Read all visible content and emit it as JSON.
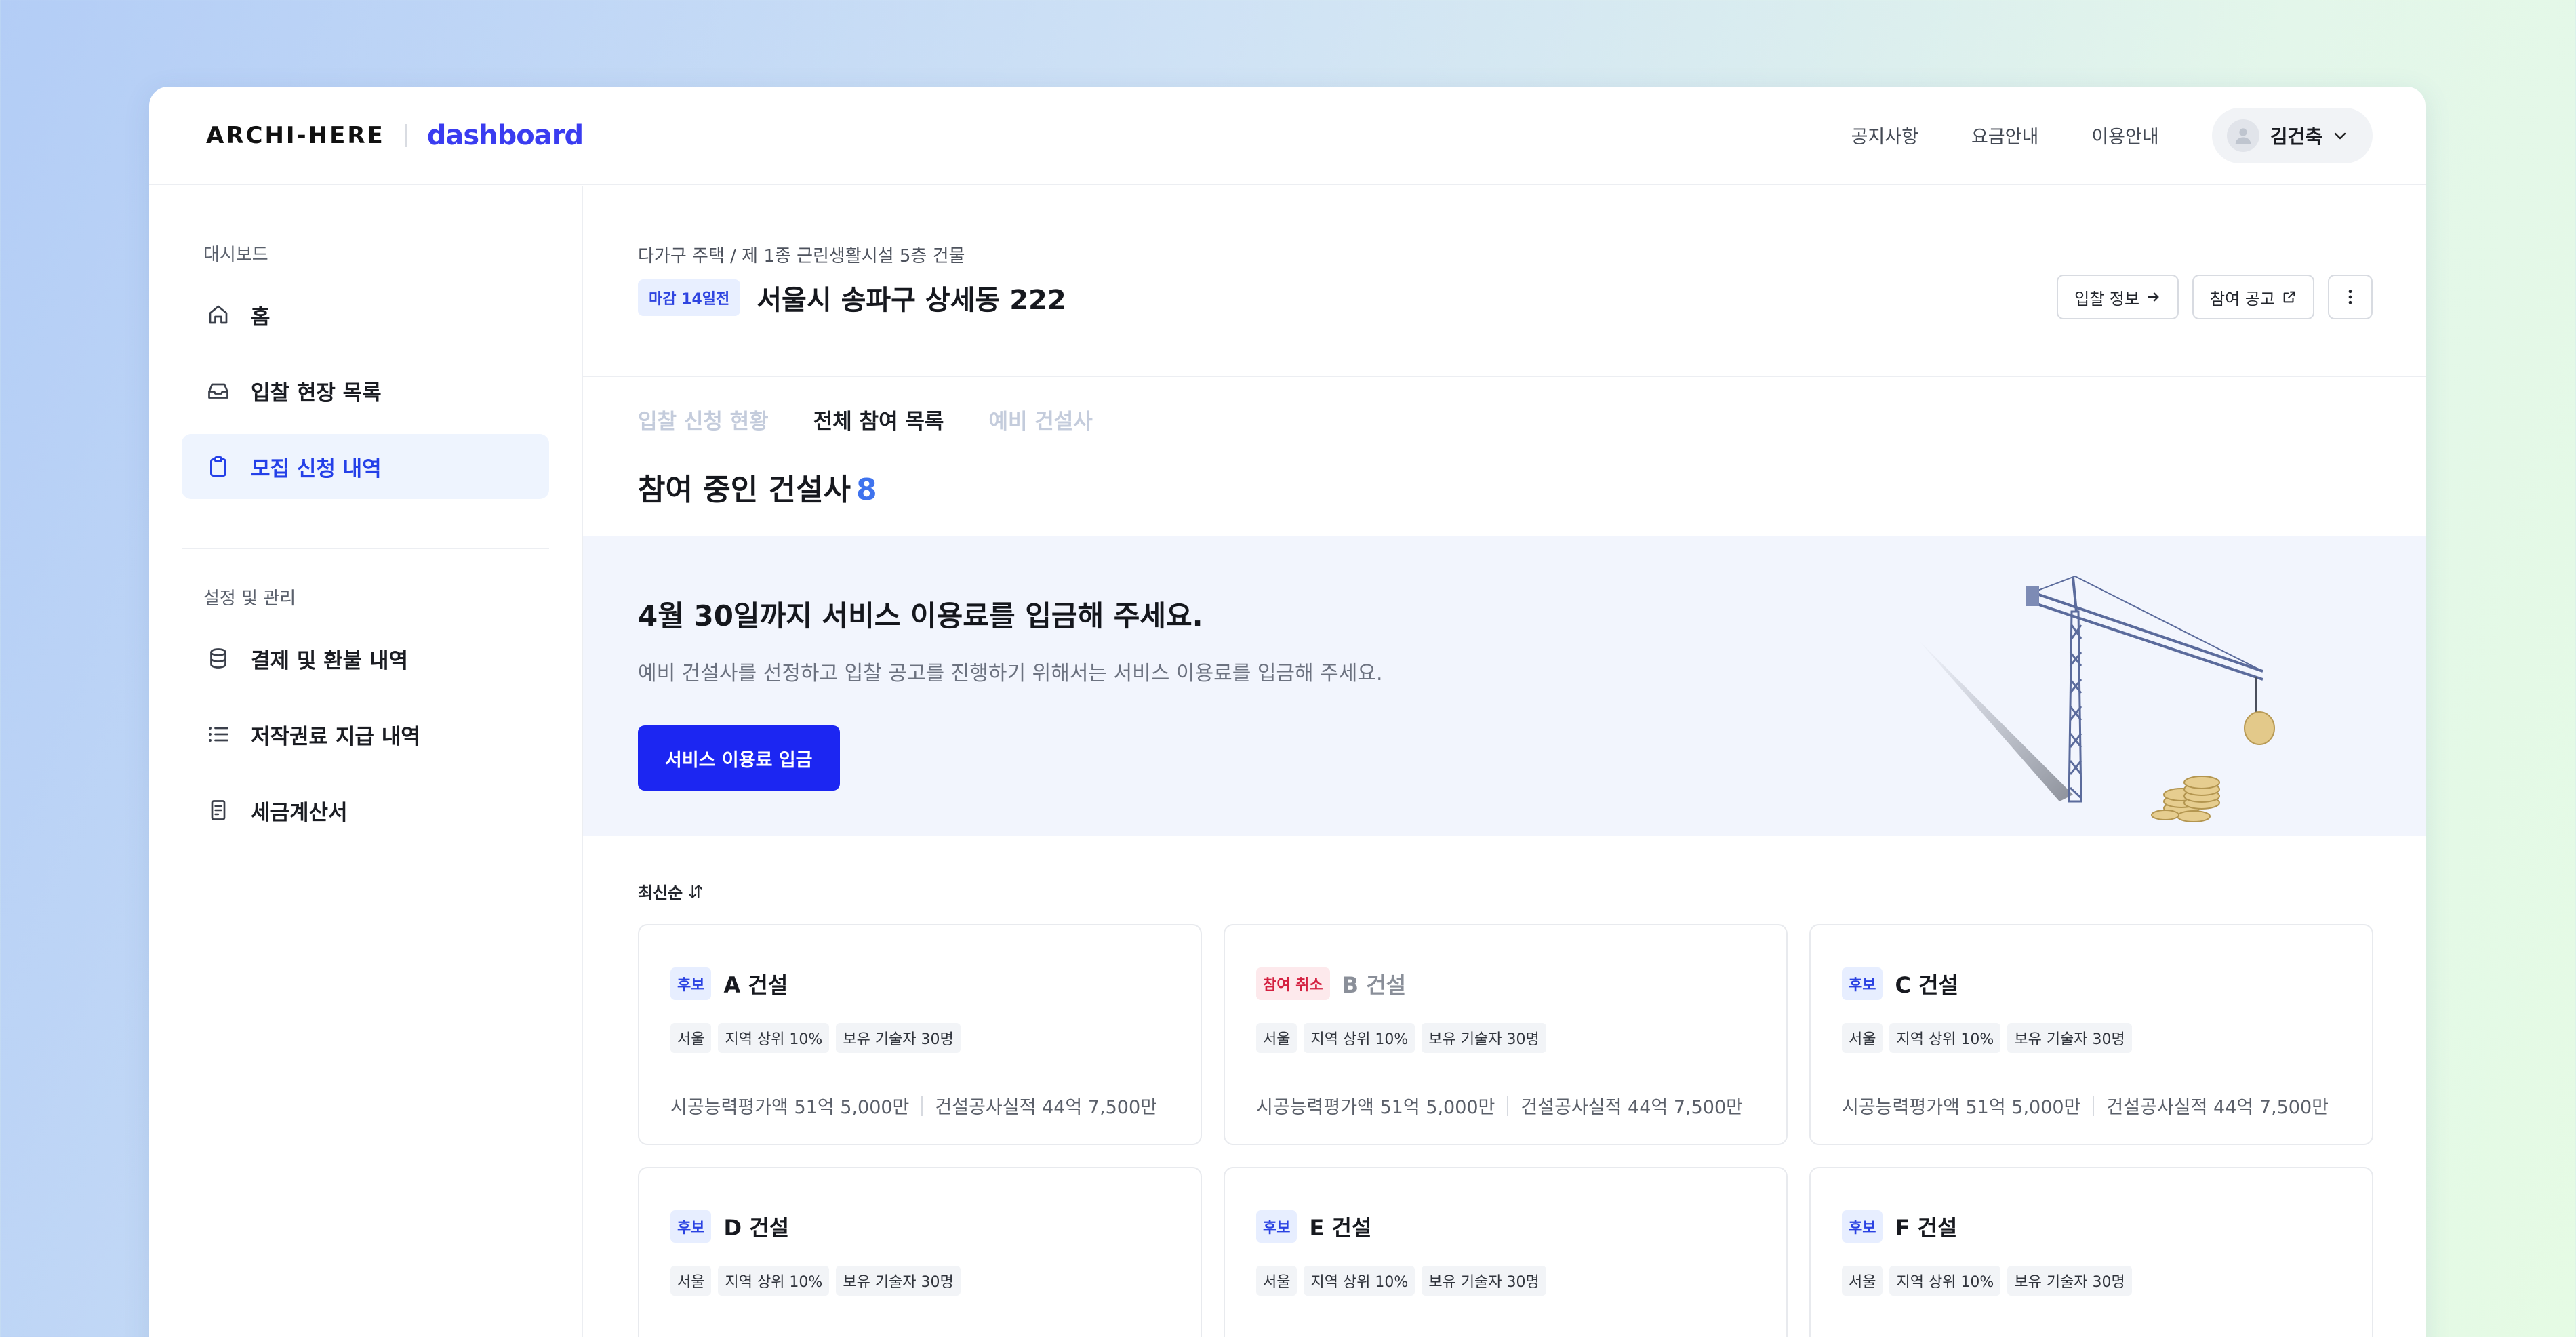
{
  "header": {
    "brand": "ARCHI-HERE",
    "brand_suffix": "dashboard",
    "nav": [
      "공지사항",
      "요금안내",
      "이용안내"
    ],
    "user_name": "김건축"
  },
  "sidebar": {
    "section1": "대시보드",
    "items1": [
      {
        "label": "홈",
        "icon": "home-icon"
      },
      {
        "label": "입찰 현장 목록",
        "icon": "inbox-icon"
      },
      {
        "label": "모집 신청 내역",
        "icon": "clipboard-icon",
        "active": true
      }
    ],
    "section2": "설정 및 관리",
    "items2": [
      {
        "label": "결제 및 환불 내역",
        "icon": "database-icon"
      },
      {
        "label": "저작권료 지급 내역",
        "icon": "list-icon"
      },
      {
        "label": "세금계산서",
        "icon": "receipt-icon"
      }
    ]
  },
  "project": {
    "breadcrumb": "다가구 주택 / 제 1종 근린생활시설 5층 건물",
    "deadline": "마감 14일전",
    "address": "서울시 송파구 상세동 222",
    "actions": {
      "bid_info": "입찰 정보",
      "notice": "참여 공고"
    }
  },
  "tabs": [
    "입찰 신청 현황",
    "전체 참여 목록",
    "예비 건설사"
  ],
  "section": {
    "title": "참여 중인 건설사",
    "count": "8"
  },
  "banner": {
    "title": "4월 30일까지 서비스 이용료를 입금해 주세요.",
    "subtitle": "예비 건설사를 선정하고 입찰 공고를 진행하기 위해서는 서비스 이용료를 입금해 주세요.",
    "button": "서비스 이용료 입금"
  },
  "sort_label": "최신순",
  "cards": [
    {
      "badge": "후보",
      "badge_type": "blue",
      "name": "A 건설",
      "tags": [
        "서울",
        "지역 상위 10%",
        "보유 기술자 30명"
      ],
      "stat1_label": "시공능력평가액",
      "stat1_value": "51억 5,000만",
      "stat2_label": "건설공사실적",
      "stat2_value": "44억 7,500만"
    },
    {
      "badge": "참여 취소",
      "badge_type": "red",
      "name": "B 건설",
      "tags": [
        "서울",
        "지역 상위 10%",
        "보유 기술자 30명"
      ],
      "stat1_label": "시공능력평가액",
      "stat1_value": "51억 5,000만",
      "stat2_label": "건설공사실적",
      "stat2_value": "44억 7,500만"
    },
    {
      "badge": "후보",
      "badge_type": "blue",
      "name": "C 건설",
      "tags": [
        "서울",
        "지역 상위 10%",
        "보유 기술자 30명"
      ],
      "stat1_label": "시공능력평가액",
      "stat1_value": "51억 5,000만",
      "stat2_label": "건설공사실적",
      "stat2_value": "44억 7,500만"
    },
    {
      "badge": "후보",
      "badge_type": "blue",
      "name": "D 건설",
      "tags": [
        "서울",
        "지역 상위 10%",
        "보유 기술자 30명"
      ]
    },
    {
      "badge": "후보",
      "badge_type": "blue",
      "name": "E 건설",
      "tags": [
        "서울",
        "지역 상위 10%",
        "보유 기술자 30명"
      ]
    },
    {
      "badge": "후보",
      "badge_type": "blue",
      "name": "F 건설",
      "tags": [
        "서울",
        "지역 상위 10%",
        "보유 기술자 30명"
      ]
    }
  ],
  "colors": {
    "accent": "#3a3cf0",
    "primary_button": "#1c26f2",
    "active_tab": "#1c1f25",
    "cancel_badge": "#d42040"
  }
}
